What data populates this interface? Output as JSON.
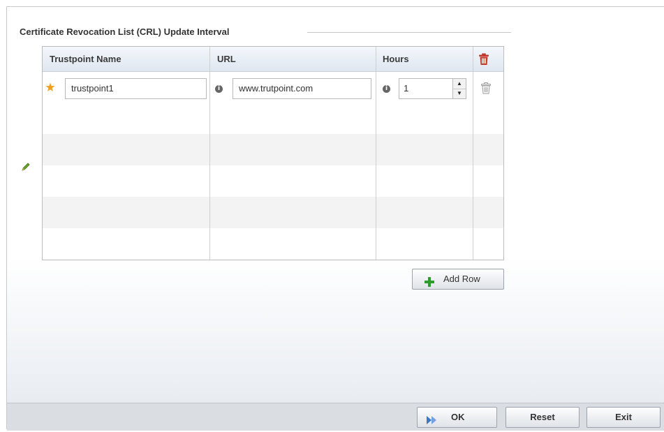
{
  "group": {
    "title": "Certificate Revocation List (CRL) Update Interval"
  },
  "table": {
    "headers": [
      "Trustpoint Name",
      "URL",
      "Hours"
    ],
    "rows": [
      {
        "trustpoint": "trustpoint1",
        "url": "www.trutpoint.com",
        "hours": "1"
      }
    ]
  },
  "icons": {
    "required": "required-star-icon",
    "info": "info-icon",
    "delete_all": "trash-red-icon",
    "delete_row": "trash-grey-icon",
    "edit": "pencil-icon",
    "add": "plus-icon",
    "ok": "double-arrow-icon"
  },
  "buttons": {
    "add_row": "Add Row",
    "ok": "OK",
    "reset": "Reset",
    "exit": "Exit"
  },
  "colors": {
    "accent_blue": "#3a78c2",
    "required_orange": "#f0a020",
    "delete_red": "#c0392b",
    "add_green": "#2f9a2f",
    "edit_green": "#4f8f1f"
  }
}
